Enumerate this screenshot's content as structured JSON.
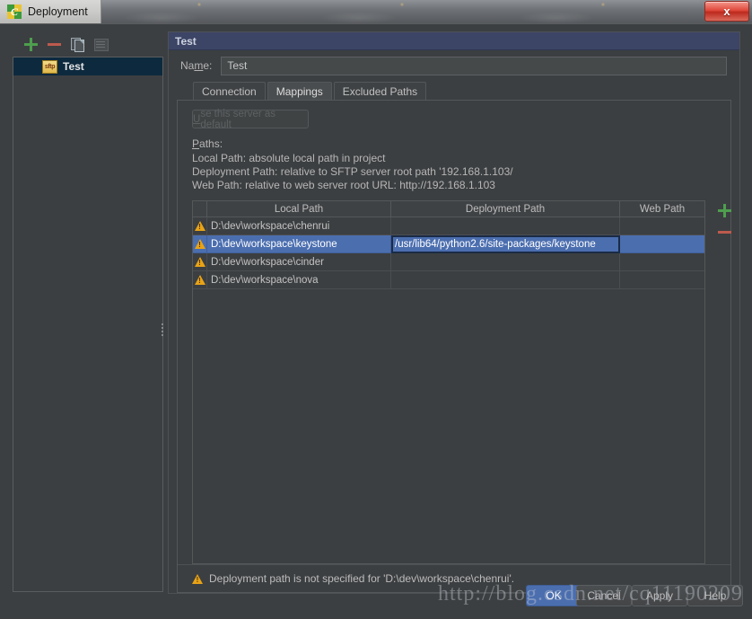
{
  "window": {
    "title": "Deployment",
    "app_icon": "pycharm-icon",
    "close_label": "x"
  },
  "sidebar": {
    "toolbar": [
      {
        "name": "add-server-button",
        "icon": "plus-icon",
        "label": "+"
      },
      {
        "name": "remove-server-button",
        "icon": "minus-icon",
        "label": "−"
      },
      {
        "name": "copy-server-button",
        "icon": "copy-icon",
        "label": ""
      },
      {
        "name": "autodetect-button",
        "icon": "autodetect-icon",
        "label": ""
      }
    ],
    "items": [
      {
        "label": "Test",
        "icon": "sftp-icon",
        "icon_text": "sftp",
        "selected": true
      }
    ]
  },
  "panel": {
    "header_title": "Test",
    "name_label": "Name:",
    "name_label_pre": "Na",
    "name_label_underlined": "m",
    "name_label_post": "e:",
    "name_value": "Test",
    "name_placeholder": "Name"
  },
  "tabs": [
    {
      "label": "Connection",
      "active": false
    },
    {
      "label": "Mappings",
      "active": true
    },
    {
      "label": "Excluded Paths",
      "active": false
    }
  ],
  "mappings": {
    "default_button_pre": "U",
    "default_button_underlined": "s",
    "default_button_post": "e this server as default",
    "default_button_label": "Use this server as default",
    "default_button_enabled": false,
    "paths_label_pre": "",
    "paths_label_underlined": "P",
    "paths_label_post": "aths:",
    "paths_label": "Paths:",
    "description_lines": [
      "Local Path: absolute local path in project",
      "Deployment Path: relative to SFTP server root path '192.168.1.103/",
      "Web Path: relative to web server root URL: http://192.168.1.103"
    ],
    "table": {
      "columns": [
        "",
        "Local Path",
        "Deployment Path",
        "Web Path"
      ],
      "rows": [
        {
          "status": "warning-icon",
          "local_path": "D:\\dev\\workspace\\chenrui",
          "deployment_path": "",
          "web_path": "",
          "selected": false,
          "editing": false
        },
        {
          "status": "warning-icon",
          "local_path": "D:\\dev\\workspace\\keystone",
          "deployment_path": "/usr/lib64/python2.6/site-packages/keystone",
          "web_path": "",
          "selected": true,
          "editing": true
        },
        {
          "status": "warning-icon",
          "local_path": "D:\\dev\\workspace\\cinder",
          "deployment_path": "",
          "web_path": "",
          "selected": false,
          "editing": false
        },
        {
          "status": "warning-icon",
          "local_path": "D:\\dev\\workspace\\nova",
          "deployment_path": "",
          "web_path": "",
          "selected": false,
          "editing": false
        }
      ],
      "side_buttons": [
        {
          "name": "add-mapping-button",
          "icon": "plus-icon"
        },
        {
          "name": "remove-mapping-button",
          "icon": "minus-icon"
        }
      ]
    },
    "validation_message": "Deployment path is not specified for 'D:\\dev\\workspace\\chenrui'.",
    "validation_icon": "warning-icon"
  },
  "footer": {
    "buttons": [
      {
        "name": "ok-button",
        "label": "OK",
        "primary": true
      },
      {
        "name": "cancel-button",
        "label": "Cancel",
        "primary": false
      },
      {
        "name": "apply-button",
        "label": "Apply",
        "primary": false
      },
      {
        "name": "help-button",
        "label": "Help",
        "primary": false
      }
    ]
  },
  "watermark": {
    "text": "http://blog.csdn.net/cq11190209"
  },
  "colors": {
    "window_bg": "#3c3f41",
    "panel_header_bg": "#3c4566",
    "selection_blue": "#4b6eaf",
    "tree_selection": "#0d293e",
    "warning_yellow": "#e8a317",
    "plus_green": "#4e9e4e",
    "minus_red": "#bd5a4e",
    "close_red": "#e0493c"
  }
}
